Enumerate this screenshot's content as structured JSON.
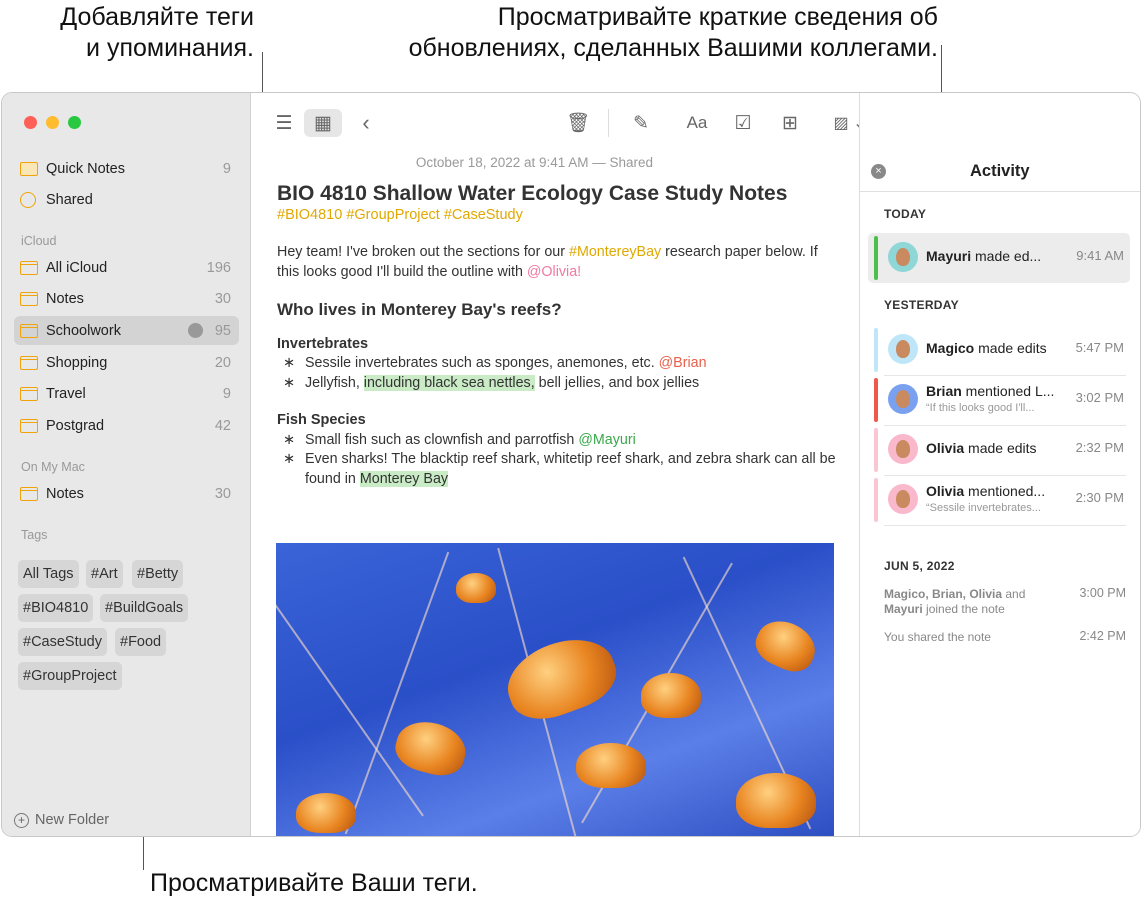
{
  "callouts": {
    "tags": "Добавляйте теги\nи упоминания.",
    "activity": "Просматривайте краткие сведения об\nобновлениях, сделанных Вашими коллегами.",
    "browse_tags": "Просматривайте Ваши теги."
  },
  "sidebar": {
    "top_items": [
      {
        "label": "Quick Notes",
        "count": "9",
        "icon": "quick-notes-icon"
      },
      {
        "label": "Shared",
        "count": "",
        "icon": "shared-person-icon"
      }
    ],
    "icloud_header": "iCloud",
    "icloud_items": [
      {
        "label": "All iCloud",
        "count": "196"
      },
      {
        "label": "Notes",
        "count": "30"
      },
      {
        "label": "Schoolwork",
        "count": "95",
        "shared": true,
        "selected": true
      },
      {
        "label": "Shopping",
        "count": "20"
      },
      {
        "label": "Travel",
        "count": "9"
      },
      {
        "label": "Postgrad",
        "count": "42"
      }
    ],
    "mac_header": "On My Mac",
    "mac_items": [
      {
        "label": "Notes",
        "count": "30"
      }
    ],
    "tags_header": "Tags",
    "tags": [
      "All Tags",
      "#Art",
      "#Betty",
      "#BIO4810",
      "#BuildGoals",
      "#CaseStudy",
      "#Food",
      "#GroupProject"
    ],
    "new_folder": "New Folder"
  },
  "note": {
    "meta": "October 18, 2022 at 9:41 AM — Shared",
    "title": "BIO 4810 Shallow Water Ecology Case Study Notes",
    "tags": "#BIO4810 #GroupProject #CaseStudy",
    "intro_a": "Hey team! I've broken out the sections for our ",
    "intro_tag": "#MontereyBay",
    "intro_b": " research paper below. If this looks good I'll build the outline with ",
    "intro_mention": "@Olivia!",
    "heading": "Who lives in Monterey Bay's reefs?",
    "sub1": "Invertebrates",
    "b1a": "Sessile invertebrates such as sponges, anemones, etc. ",
    "b1m": "@Brian",
    "b2a": "Jellyfish, ",
    "b2h": "including black sea nettles,",
    "b2b": " bell jellies, and box jellies",
    "sub2": "Fish Species",
    "b3a": "Small fish such as clownfish and parrotfish ",
    "b3m": "@Mayuri",
    "b4a": "Even sharks! The blacktip reef shark, whitetip reef shark, and zebra shark can all be found in ",
    "b4h": "Monterey Bay"
  },
  "activity": {
    "title": "Activity",
    "today": "TODAY",
    "yesterday": "YESTERDAY",
    "older": "JUN 5, 2022",
    "items": [
      {
        "name": "Mayuri",
        "text": " made ed...",
        "sub": "",
        "time": "9:41 AM",
        "color": "#4cc04a"
      },
      {
        "name": "Magico",
        "text": " made edits",
        "sub": "",
        "time": "5:47 PM",
        "color": "#bfe6f8"
      },
      {
        "name": "Brian",
        "text": " mentioned L...",
        "sub": "“If this looks good I'll...",
        "time": "3:02 PM",
        "color": "#ee5a4a"
      },
      {
        "name": "Olivia",
        "text": " made edits",
        "sub": "",
        "time": "2:32 PM",
        "color": "#f9c6d4"
      },
      {
        "name": "Olivia",
        "text": " mentioned...",
        "sub": "“Sessile invertebrates...",
        "time": "2:30 PM",
        "color": "#f9c6d4"
      }
    ],
    "old1_names": "Magico, Brian, Olivia",
    "old1_and": " and",
    "old1_names2": "Mayuri",
    "old1_rest": " joined the note",
    "old1_time": "3:00 PM",
    "old2": "You shared the note",
    "old2_time": "2:42 PM"
  },
  "colors": {
    "accent": "#f0a30a",
    "tag": "#e0a800",
    "highlight": "#c9ebc6"
  }
}
